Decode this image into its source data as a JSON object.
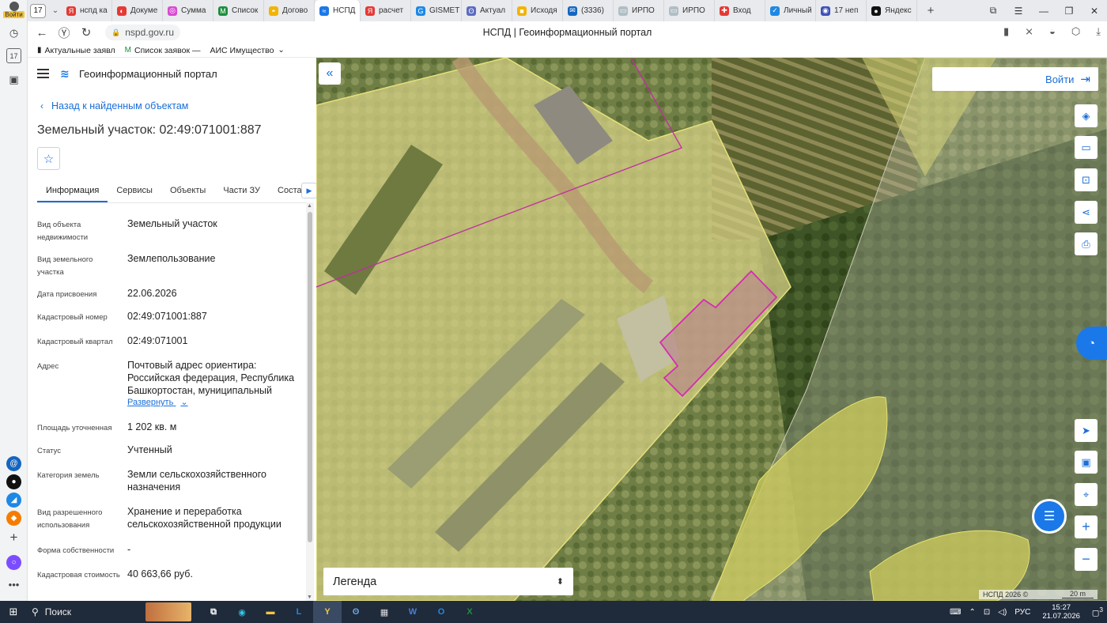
{
  "browser": {
    "avatar_label": "Войти",
    "tab_count": "17",
    "tabs": [
      {
        "label": "нспд ка",
        "color": "#e53935",
        "glyph": "Я"
      },
      {
        "label": "Докуме",
        "color": "#e53935",
        "glyph": "◐"
      },
      {
        "label": "Сумма",
        "color": "#d84bd1",
        "glyph": "◎"
      },
      {
        "label": "Список",
        "color": "#1e8e3e",
        "glyph": "M"
      },
      {
        "label": "Догово",
        "color": "#f2b400",
        "glyph": "◓"
      },
      {
        "label": "НСПД",
        "color": "#1b78e8",
        "glyph": "≈",
        "active": true
      },
      {
        "label": "расчет",
        "color": "#e53935",
        "glyph": "Я"
      },
      {
        "label": "GISMET",
        "color": "#1e88e5",
        "glyph": "G"
      },
      {
        "label": "Актуал",
        "color": "#5c6bc0",
        "glyph": "ʘ"
      },
      {
        "label": "Исходя",
        "color": "#f2b400",
        "glyph": "■"
      },
      {
        "label": "(3336)",
        "color": "#1565c0",
        "glyph": "✉"
      },
      {
        "label": "ИРПО",
        "color": "#b0bec5",
        "glyph": "▭"
      },
      {
        "label": "ИРПО",
        "color": "#b0bec5",
        "glyph": "▭"
      },
      {
        "label": "Вход",
        "color": "#e53935",
        "glyph": "✚"
      },
      {
        "label": "Личный",
        "color": "#1e88e5",
        "glyph": "✓"
      },
      {
        "label": "17 неп",
        "color": "#3f51b5",
        "glyph": "◉"
      },
      {
        "label": "Яндекс",
        "color": "#111111",
        "glyph": "●"
      }
    ],
    "url": "nspd.gov.ru",
    "page_title": "НСПД | Геоинформационный портал",
    "bookmarks": [
      {
        "label": "Актуальные заявл",
        "icon": "bookmark-icon"
      },
      {
        "label": "Список заявок —",
        "icon": "gmail-icon"
      },
      {
        "label": "АИС Имущество",
        "icon": "folder-icon"
      }
    ]
  },
  "portal": {
    "name": "Геоинформационный портал",
    "back_link": "Назад к найденным объектам",
    "object_title": "Земельный участок: 02:49:071001:887",
    "tabs": [
      "Информация",
      "Сервисы",
      "Объекты",
      "Части ЗУ",
      "Состав"
    ],
    "properties": [
      {
        "label": "Вид объекта недвижимости",
        "value": "Земельный участок"
      },
      {
        "label": "Вид земельного участка",
        "value": "Землепользование"
      },
      {
        "label": "Дата присвоения",
        "value": "22.06.2026"
      },
      {
        "label": "Кадастровый номер",
        "value": "02:49:071001:887"
      },
      {
        "label": "Кадастровый квартал",
        "value": "02:49:071001"
      },
      {
        "label": "Адрес",
        "value": "Почтовый адрес ориентира: Российская федерация, Республика Башкортостан, муниципальный"
      },
      {
        "label": "Площадь уточненная",
        "value": "1 202 кв. м"
      },
      {
        "label": "Статус",
        "value": "Учтенный"
      },
      {
        "label": "Категория земель",
        "value": "Земли сельскохозяйственного назначения"
      },
      {
        "label": "Вид разрешенного использования",
        "value": "Хранение и переработка сельскохозяйственной продукции"
      },
      {
        "label": "Форма собственности",
        "value": "-"
      },
      {
        "label": "Кадастровая стоимость",
        "value": "40 663,66 руб."
      }
    ],
    "expand_label": "Развернуть"
  },
  "map": {
    "login_label": "Войти",
    "legend_label": "Легенда",
    "copyright": "НСПД 2026 ©",
    "scale": "20 m"
  },
  "taskbar": {
    "search_label": "Поиск",
    "lang": "РУС",
    "time": "15:27",
    "date": "21.07.2026",
    "notif": "3"
  }
}
